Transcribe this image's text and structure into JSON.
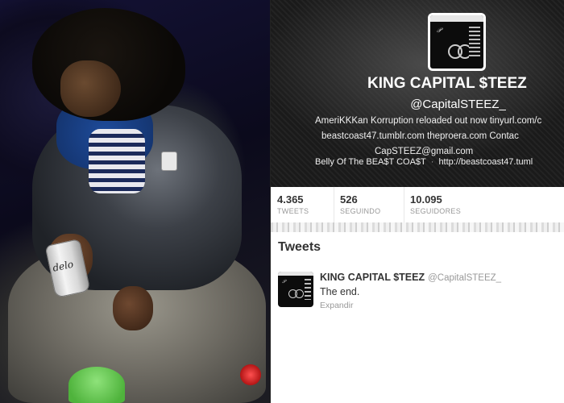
{
  "photo": {
    "can_label": "delo"
  },
  "profile": {
    "name": "KING CAPITAL $TEEZ",
    "handle": "@CapitalSTEEZ_",
    "bio_line1": "AmeriKKKan Korruption reloaded out now tinyurl.com/c",
    "bio_line2": "beastcoast47.tumblr.com theproera.com Contac",
    "bio_line3": "CapSTEEZ@gmail.com",
    "location": "Belly Of The BEA$T COA$T",
    "separator": "·",
    "url": "http://beastcoast47.tuml"
  },
  "stats": [
    {
      "value": "4.365",
      "label": "TWEETS"
    },
    {
      "value": "526",
      "label": "SEGUINDO"
    },
    {
      "value": "10.095",
      "label": "SEGUIDORES"
    }
  ],
  "tweets_title": "Tweets",
  "tweet": {
    "name": "KING CAPITAL $TEEZ",
    "handle": "@CapitalSTEEZ_",
    "text": "The end.",
    "expand": "Expandir"
  },
  "colors": {
    "header_bg": "#1a1a1a",
    "text_dark": "#333333",
    "text_muted": "#999999"
  }
}
